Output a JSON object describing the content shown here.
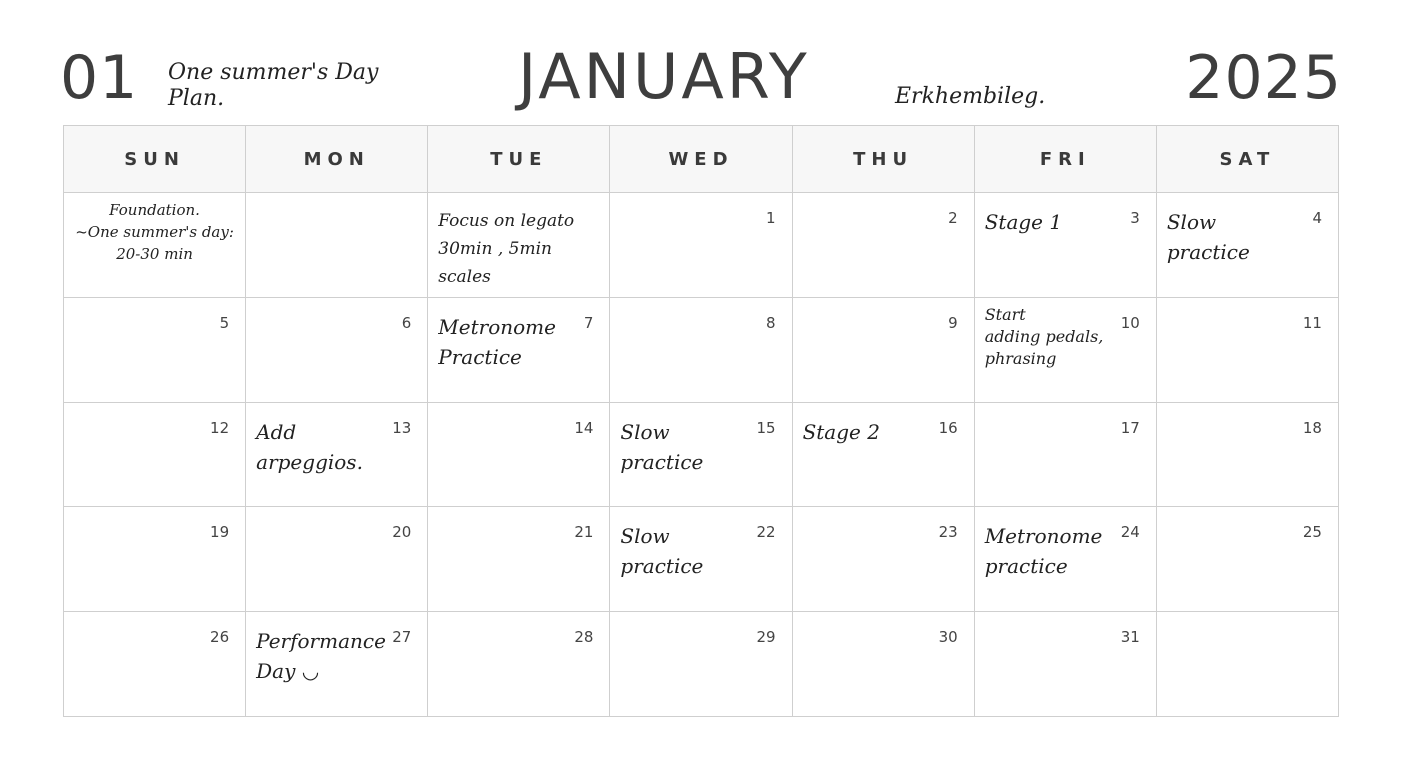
{
  "header": {
    "month_number": "01",
    "plan_title": "One summer's Day Plan.",
    "month_name": "JANUARY",
    "author": "Erkhembileg.",
    "year": "2025"
  },
  "weekdays": [
    "SUN",
    "MON",
    "TUE",
    "WED",
    "THU",
    "FRI",
    "SAT"
  ],
  "weeks": [
    [
      {
        "day": "",
        "note": [
          "Foundation.",
          "~One summer's day:",
          "20-30 min"
        ]
      },
      {
        "day": "",
        "note": []
      },
      {
        "day": "",
        "note": [
          "Focus on legato",
          "30min , 5min scales"
        ]
      },
      {
        "day": "1",
        "note": []
      },
      {
        "day": "2",
        "note": []
      },
      {
        "day": "3",
        "note": [
          "Stage 1"
        ]
      },
      {
        "day": "4",
        "note": [
          "Slow",
          "practice"
        ]
      }
    ],
    [
      {
        "day": "5",
        "note": []
      },
      {
        "day": "6",
        "note": []
      },
      {
        "day": "7",
        "note": [
          "Metronome",
          "Practice"
        ]
      },
      {
        "day": "8",
        "note": []
      },
      {
        "day": "9",
        "note": []
      },
      {
        "day": "10",
        "note": [
          "Start",
          "adding pedals,",
          "phrasing"
        ]
      },
      {
        "day": "11",
        "note": []
      }
    ],
    [
      {
        "day": "12",
        "note": []
      },
      {
        "day": "13",
        "note": [
          "Add",
          "arpeggios."
        ]
      },
      {
        "day": "14",
        "note": []
      },
      {
        "day": "15",
        "note": [
          "Slow",
          "practice"
        ]
      },
      {
        "day": "16",
        "note": [
          "Stage 2"
        ]
      },
      {
        "day": "17",
        "note": []
      },
      {
        "day": "18",
        "note": []
      }
    ],
    [
      {
        "day": "19",
        "note": []
      },
      {
        "day": "20",
        "note": []
      },
      {
        "day": "21",
        "note": []
      },
      {
        "day": "22",
        "note": [
          "Slow",
          "practice"
        ]
      },
      {
        "day": "23",
        "note": []
      },
      {
        "day": "24",
        "note": [
          "Metronome",
          "practice"
        ]
      },
      {
        "day": "25",
        "note": []
      }
    ],
    [
      {
        "day": "26",
        "note": []
      },
      {
        "day": "27",
        "note": [
          "Performance",
          "Day ◡"
        ]
      },
      {
        "day": "28",
        "note": []
      },
      {
        "day": "29",
        "note": []
      },
      {
        "day": "30",
        "note": []
      },
      {
        "day": "31",
        "note": []
      },
      {
        "day": "",
        "note": []
      }
    ]
  ]
}
